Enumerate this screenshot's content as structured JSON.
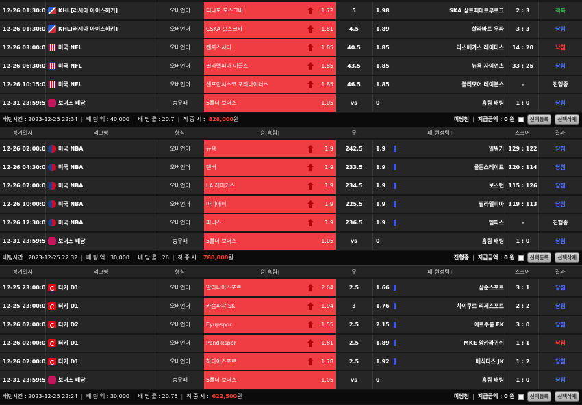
{
  "colors": {
    "home_bg": "#ef3d43",
    "result_win": "#4a6cff",
    "result_lose": "#ff3b30",
    "result_refund": "#34c759",
    "page_bg": "#161616"
  },
  "headers": {
    "date": "경기일시",
    "league": "리그명",
    "type": "형식",
    "home": "승[홈팀]",
    "draw": "무",
    "away": "패[원정팀]",
    "score": "스코어",
    "result": "결과"
  },
  "blocks": [
    {
      "rows": [
        {
          "date": "12-26 01:30:00",
          "flag": "khl",
          "league": "KHL[러시아 아이스하키]",
          "type": "오버언더",
          "home": "디나모 모스크바",
          "home_odds": "1.72",
          "up": true,
          "draw": "5",
          "away_odds": "1.98",
          "away_bar": false,
          "away": "SKA 상트페테르부르크",
          "score": "2 : 3",
          "result": "적특",
          "rcls": "res-green"
        },
        {
          "date": "12-26 01:30:00",
          "flag": "khl",
          "league": "KHL[러시아 아이스하키]",
          "type": "오버언더",
          "home": "CSKA 모스크바",
          "home_odds": "1.81",
          "up": true,
          "draw": "4.5",
          "away_odds": "1.89",
          "away_bar": false,
          "away": "살라바트 우파",
          "score": "3 : 3",
          "result": "당첨",
          "rcls": "res-blue"
        },
        {
          "date": "12-26 03:00:00",
          "flag": "nfl",
          "league": "미국 NFL",
          "type": "오버언더",
          "home": "캔자스시티",
          "home_odds": "1.85",
          "up": true,
          "draw": "40.5",
          "away_odds": "1.85",
          "away_bar": false,
          "away": "라스베가스 레이더스",
          "score": "14 : 20",
          "result": "낙첨",
          "rcls": "res-red"
        },
        {
          "date": "12-26 06:30:00",
          "flag": "nfl",
          "league": "미국 NFL",
          "type": "오버언더",
          "home": "필라델피아 이글스",
          "home_odds": "1.85",
          "up": true,
          "draw": "43.5",
          "away_odds": "1.85",
          "away_bar": false,
          "away": "뉴욕 자이언츠",
          "score": "33 : 25",
          "result": "당첨",
          "rcls": "res-blue"
        },
        {
          "date": "12-26 10:15:00",
          "flag": "nfl",
          "league": "미국 NFL",
          "type": "오버언더",
          "home": "샌프란시스코 포티나이너스",
          "home_odds": "1.85",
          "up": true,
          "draw": "46.5",
          "away_odds": "1.85",
          "away_bar": false,
          "away": "볼티모어 레이븐스",
          "score": "-",
          "result": "진행중",
          "rcls": "res-white"
        },
        {
          "date": "12-31 23:59:59",
          "flag": "bonus",
          "league": "보너스 배당",
          "type": "승무패",
          "home": "5폴더 보너스",
          "home_odds": "1.05",
          "up": false,
          "draw": "vs",
          "away_odds": "0",
          "away_bar": false,
          "away": "홈팀 배팅",
          "score": "1 : 0",
          "result": "당첨",
          "rcls": "res-blue"
        }
      ],
      "summary": {
        "time_label": "배팅시간 : 2023-12-25 22:34",
        "amount_label": "배 팅 액 : 40,000",
        "rate_label": "배 당 률 : 20.7",
        "win_label": "적 중 시 :",
        "win_value": "828,000",
        "win_unit": "원",
        "status": "미당첨",
        "pay_label": "지급금액 : 0 원",
        "btn_register": "선택등록",
        "btn_delete": "선택삭제"
      }
    },
    {
      "rows": [
        {
          "date": "12-26 02:00:00",
          "flag": "nba",
          "league": "미국 NBA",
          "type": "오버언더",
          "home": "뉴욕",
          "home_odds": "1.9",
          "up": true,
          "draw": "242.5",
          "away_odds": "1.9",
          "away_bar": true,
          "away": "밀워키",
          "score": "129 : 122",
          "result": "당첨",
          "rcls": "res-blue"
        },
        {
          "date": "12-26 04:30:00",
          "flag": "nba",
          "league": "미국 NBA",
          "type": "오버언더",
          "home": "덴버",
          "home_odds": "1.9",
          "up": true,
          "draw": "233.5",
          "away_odds": "1.9",
          "away_bar": true,
          "away": "골든스테이트",
          "score": "120 : 114",
          "result": "당첨",
          "rcls": "res-blue"
        },
        {
          "date": "12-26 07:00:00",
          "flag": "nba",
          "league": "미국 NBA",
          "type": "오버언더",
          "home": "LA 레이커스",
          "home_odds": "1.9",
          "up": true,
          "draw": "234.5",
          "away_odds": "1.9",
          "away_bar": true,
          "away": "보스턴",
          "score": "115 : 126",
          "result": "당첨",
          "rcls": "res-blue"
        },
        {
          "date": "12-26 10:00:00",
          "flag": "nba",
          "league": "미국 NBA",
          "type": "오버언더",
          "home": "마이애미",
          "home_odds": "1.9",
          "up": true,
          "draw": "225.5",
          "away_odds": "1.9",
          "away_bar": true,
          "away": "필라델피아",
          "score": "119 : 113",
          "result": "당첨",
          "rcls": "res-blue"
        },
        {
          "date": "12-26 12:30:00",
          "flag": "nba",
          "league": "미국 NBA",
          "type": "오버언더",
          "home": "피닉스",
          "home_odds": "1.9",
          "up": true,
          "draw": "236.5",
          "away_odds": "1.9",
          "away_bar": true,
          "away": "멤피스",
          "score": "-",
          "result": "진행중",
          "rcls": "res-white"
        },
        {
          "date": "12-31 23:59:59",
          "flag": "bonus",
          "league": "보너스 배당",
          "type": "승무패",
          "home": "5폴더 보너스",
          "home_odds": "1.05",
          "up": false,
          "draw": "vs",
          "away_odds": "0",
          "away_bar": false,
          "away": "홈팀 배팅",
          "score": "1 : 0",
          "result": "당첨",
          "rcls": "res-blue"
        }
      ],
      "summary": {
        "time_label": "배팅시간 : 2023-12-25 22:32",
        "amount_label": "배 팅 액 : 30,000",
        "rate_label": "배 당 률 : 26",
        "win_label": "적 중 시 :",
        "win_value": "780,000",
        "win_unit": "원",
        "status": "진행중",
        "pay_label": "지급금액 : 0 원",
        "btn_register": "선택등록",
        "btn_delete": "선택삭제"
      }
    },
    {
      "rows": [
        {
          "date": "12-25 23:00:00",
          "flag": "tr",
          "league": "터키 D1",
          "type": "오버언더",
          "home": "알라니아스포르",
          "home_odds": "2.04",
          "up": true,
          "draw": "2.5",
          "away_odds": "1.66",
          "away_bar": true,
          "away": "삼순스포르",
          "score": "3 : 1",
          "result": "당첨",
          "rcls": "res-blue"
        },
        {
          "date": "12-25 23:00:00",
          "flag": "tr",
          "league": "터키 D1",
          "type": "오버언더",
          "home": "카슴파샤 SK",
          "home_odds": "1.94",
          "up": true,
          "draw": "3",
          "away_odds": "1.76",
          "away_bar": true,
          "away": "차이쿠르 리제스포르",
          "score": "2 : 2",
          "result": "당첨",
          "rcls": "res-blue"
        },
        {
          "date": "12-26 02:00:00",
          "flag": "tr",
          "league": "터키 D2",
          "type": "오버언더",
          "home": "Eyupspor",
          "home_odds": "1.55",
          "up": true,
          "draw": "2.5",
          "away_odds": "2.15",
          "away_bar": true,
          "away": "에르주룸 FK",
          "score": "3 : 0",
          "result": "당첨",
          "rcls": "res-blue"
        },
        {
          "date": "12-26 02:00:00",
          "flag": "tr",
          "league": "터키 D1",
          "type": "오버언더",
          "home": "Pendikspor",
          "home_odds": "1.81",
          "up": true,
          "draw": "2.5",
          "away_odds": "1.89",
          "away_bar": true,
          "away": "MKE 앙카라귀쉬",
          "score": "1 : 1",
          "result": "낙첨",
          "rcls": "res-red"
        },
        {
          "date": "12-26 02:00:00",
          "flag": "tr",
          "league": "터키 D1",
          "type": "오버언더",
          "home": "하타이스포르",
          "home_odds": "1.78",
          "up": true,
          "draw": "2.5",
          "away_odds": "1.92",
          "away_bar": true,
          "away": "베식타스 JK",
          "score": "1 : 2",
          "result": "당첨",
          "rcls": "res-blue"
        },
        {
          "date": "12-31 23:59:59",
          "flag": "bonus",
          "league": "보너스 배당",
          "type": "승무패",
          "home": "5폴더 보너스",
          "home_odds": "1.05",
          "up": false,
          "draw": "vs",
          "away_odds": "0",
          "away_bar": false,
          "away": "홈팀 배팅",
          "score": "1 : 0",
          "result": "당첨",
          "rcls": "res-blue"
        }
      ],
      "summary": {
        "time_label": "배팅시간 : 2023-12-25 22:24",
        "amount_label": "배 팅 액 : 30,000",
        "rate_label": "배 당 률 : 20.75",
        "win_label": "적 중 시 :",
        "win_value": "622,500",
        "win_unit": "원",
        "status": "미당첨",
        "pay_label": "지급금액 : 0 원",
        "btn_register": "선택등록",
        "btn_delete": "선택삭제"
      }
    }
  ]
}
